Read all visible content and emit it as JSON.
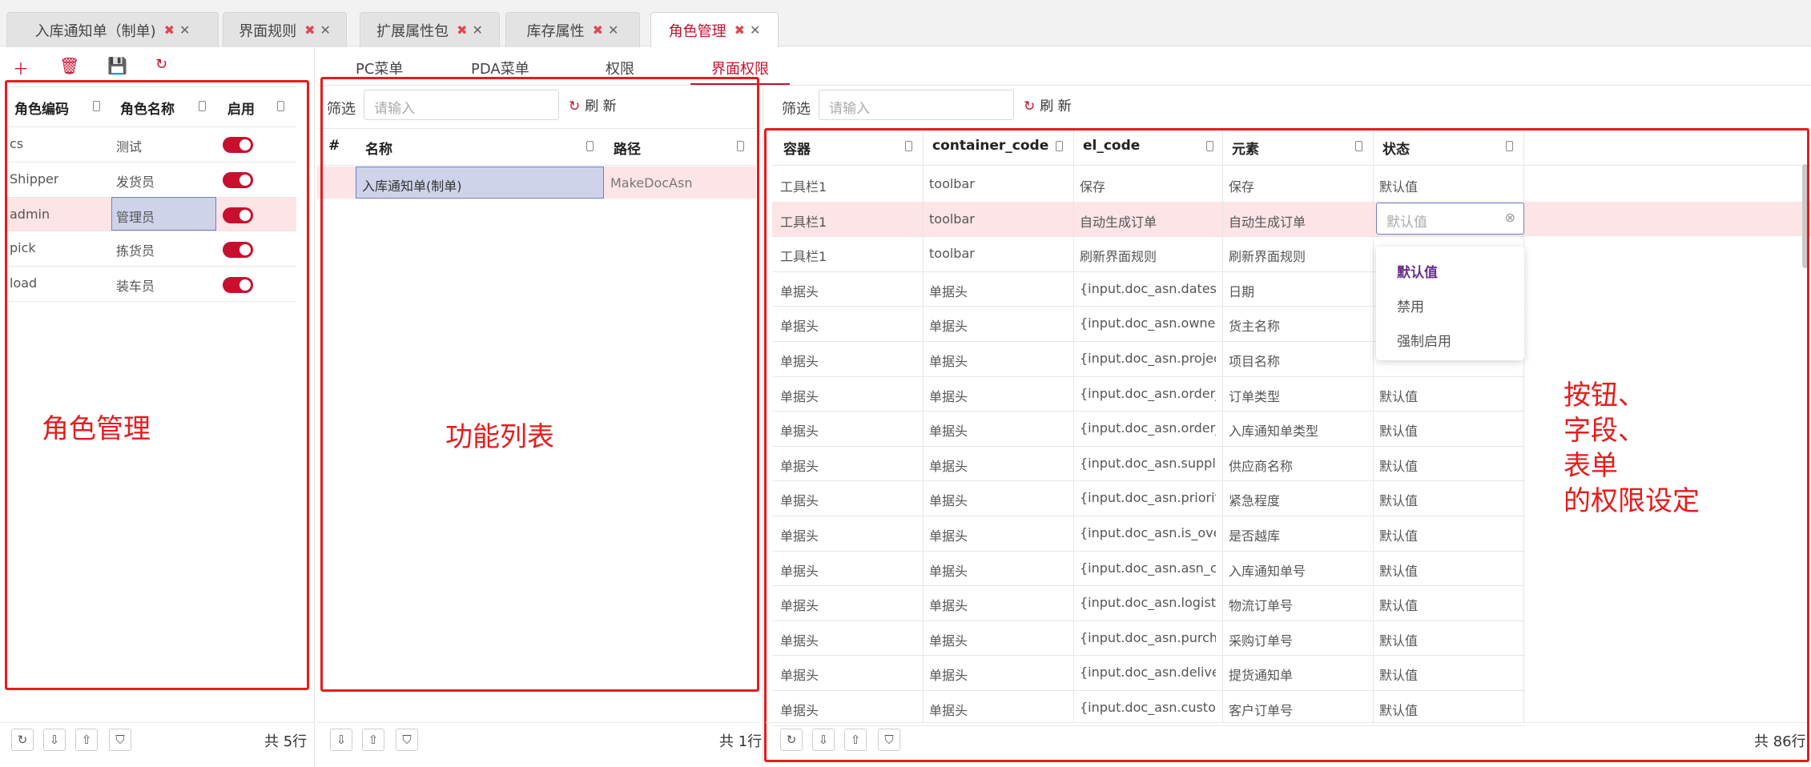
{
  "tabs": [
    {
      "label": "入库通知单（制单)",
      "active": false
    },
    {
      "label": "界面规则",
      "active": false
    },
    {
      "label": "扩展属性包",
      "active": false
    },
    {
      "label": "库存属性",
      "active": false
    },
    {
      "label": "角色管理",
      "active": true
    }
  ],
  "roles": {
    "columns": [
      "角色编码",
      "角色名称",
      "启用"
    ],
    "rows": [
      {
        "code": "cs",
        "name": "测试",
        "enabled": true
      },
      {
        "code": "Shipper",
        "name": "发货员",
        "enabled": true
      },
      {
        "code": "admin",
        "name": "管理员",
        "enabled": true
      },
      {
        "code": "pick",
        "name": "拣货员",
        "enabled": true
      },
      {
        "code": "load",
        "name": "装车员",
        "enabled": true
      }
    ],
    "count": "共 5行",
    "annotation": "角色管理"
  },
  "subtabs": [
    "PC菜单",
    "PDA菜单",
    "权限",
    "界面权限"
  ],
  "functions": {
    "filter_label": "筛选",
    "filter_placeholder": "请输入",
    "refresh_label": "刷 新",
    "columns": [
      "#",
      "名称",
      "路径"
    ],
    "rows": [
      {
        "name": "入库通知单(制单)",
        "path": "MakeDocAsn"
      }
    ],
    "count": "共 1行",
    "annotation": "功能列表"
  },
  "permissions": {
    "filter_label": "筛选",
    "filter_placeholder": "请输入",
    "refresh_label": "刷 新",
    "columns": [
      "容器",
      "container_code",
      "el_code",
      "元素",
      "状态"
    ],
    "rows": [
      [
        "工具栏1",
        "toolbar",
        "保存",
        "保存",
        "默认值"
      ],
      [
        "工具栏1",
        "toolbar",
        "自动生成订单",
        "自动生成订单",
        ""
      ],
      [
        "工具栏1",
        "toolbar",
        "刷新界面规则",
        "刷新界面规则",
        ""
      ],
      [
        "单据头",
        "单据头",
        "{input.doc_asn.dates}",
        "日期",
        ""
      ],
      [
        "单据头",
        "单据头",
        "{input.doc_asn.owner...",
        "货主名称",
        ""
      ],
      [
        "单据头",
        "单据头",
        "{input.doc_asn.project...",
        "项目名称",
        ""
      ],
      [
        "单据头",
        "单据头",
        "{input.doc_asn.order_...",
        "订单类型",
        "默认值"
      ],
      [
        "单据头",
        "单据头",
        "{input.doc_asn.order_...",
        "入库通知单类型",
        "默认值"
      ],
      [
        "单据头",
        "单据头",
        "{input.doc_asn.supplie...",
        "供应商名称",
        "默认值"
      ],
      [
        "单据头",
        "单据头",
        "{input.doc_asn.priority}",
        "紧急程度",
        "默认值"
      ],
      [
        "单据头",
        "单据头",
        "{input.doc_asn.is_over...",
        "是否越库",
        "默认值"
      ],
      [
        "单据头",
        "单据头",
        "{input.doc_asn.asn_co...",
        "入库通知单号",
        "默认值"
      ],
      [
        "单据头",
        "单据头",
        "{input.doc_asn.logistic...",
        "物流订单号",
        "默认值"
      ],
      [
        "单据头",
        "单据头",
        "{input.doc_asn.purcha...",
        "采购订单号",
        "默认值"
      ],
      [
        "单据头",
        "单据头",
        "{input.doc_asn.deliver...",
        "提货通知单",
        "默认值"
      ],
      [
        "单据头",
        "单据头",
        "{input.doc_asn.custo...",
        "客户订单号",
        "默认值"
      ]
    ],
    "edit_placeholder": "默认值",
    "dropdown_options": [
      "默认值",
      "禁用",
      "强制启用"
    ],
    "count": "共 86行",
    "annotation_lines": [
      "按钮、",
      "字段、",
      "表单",
      "的权限设定"
    ]
  }
}
